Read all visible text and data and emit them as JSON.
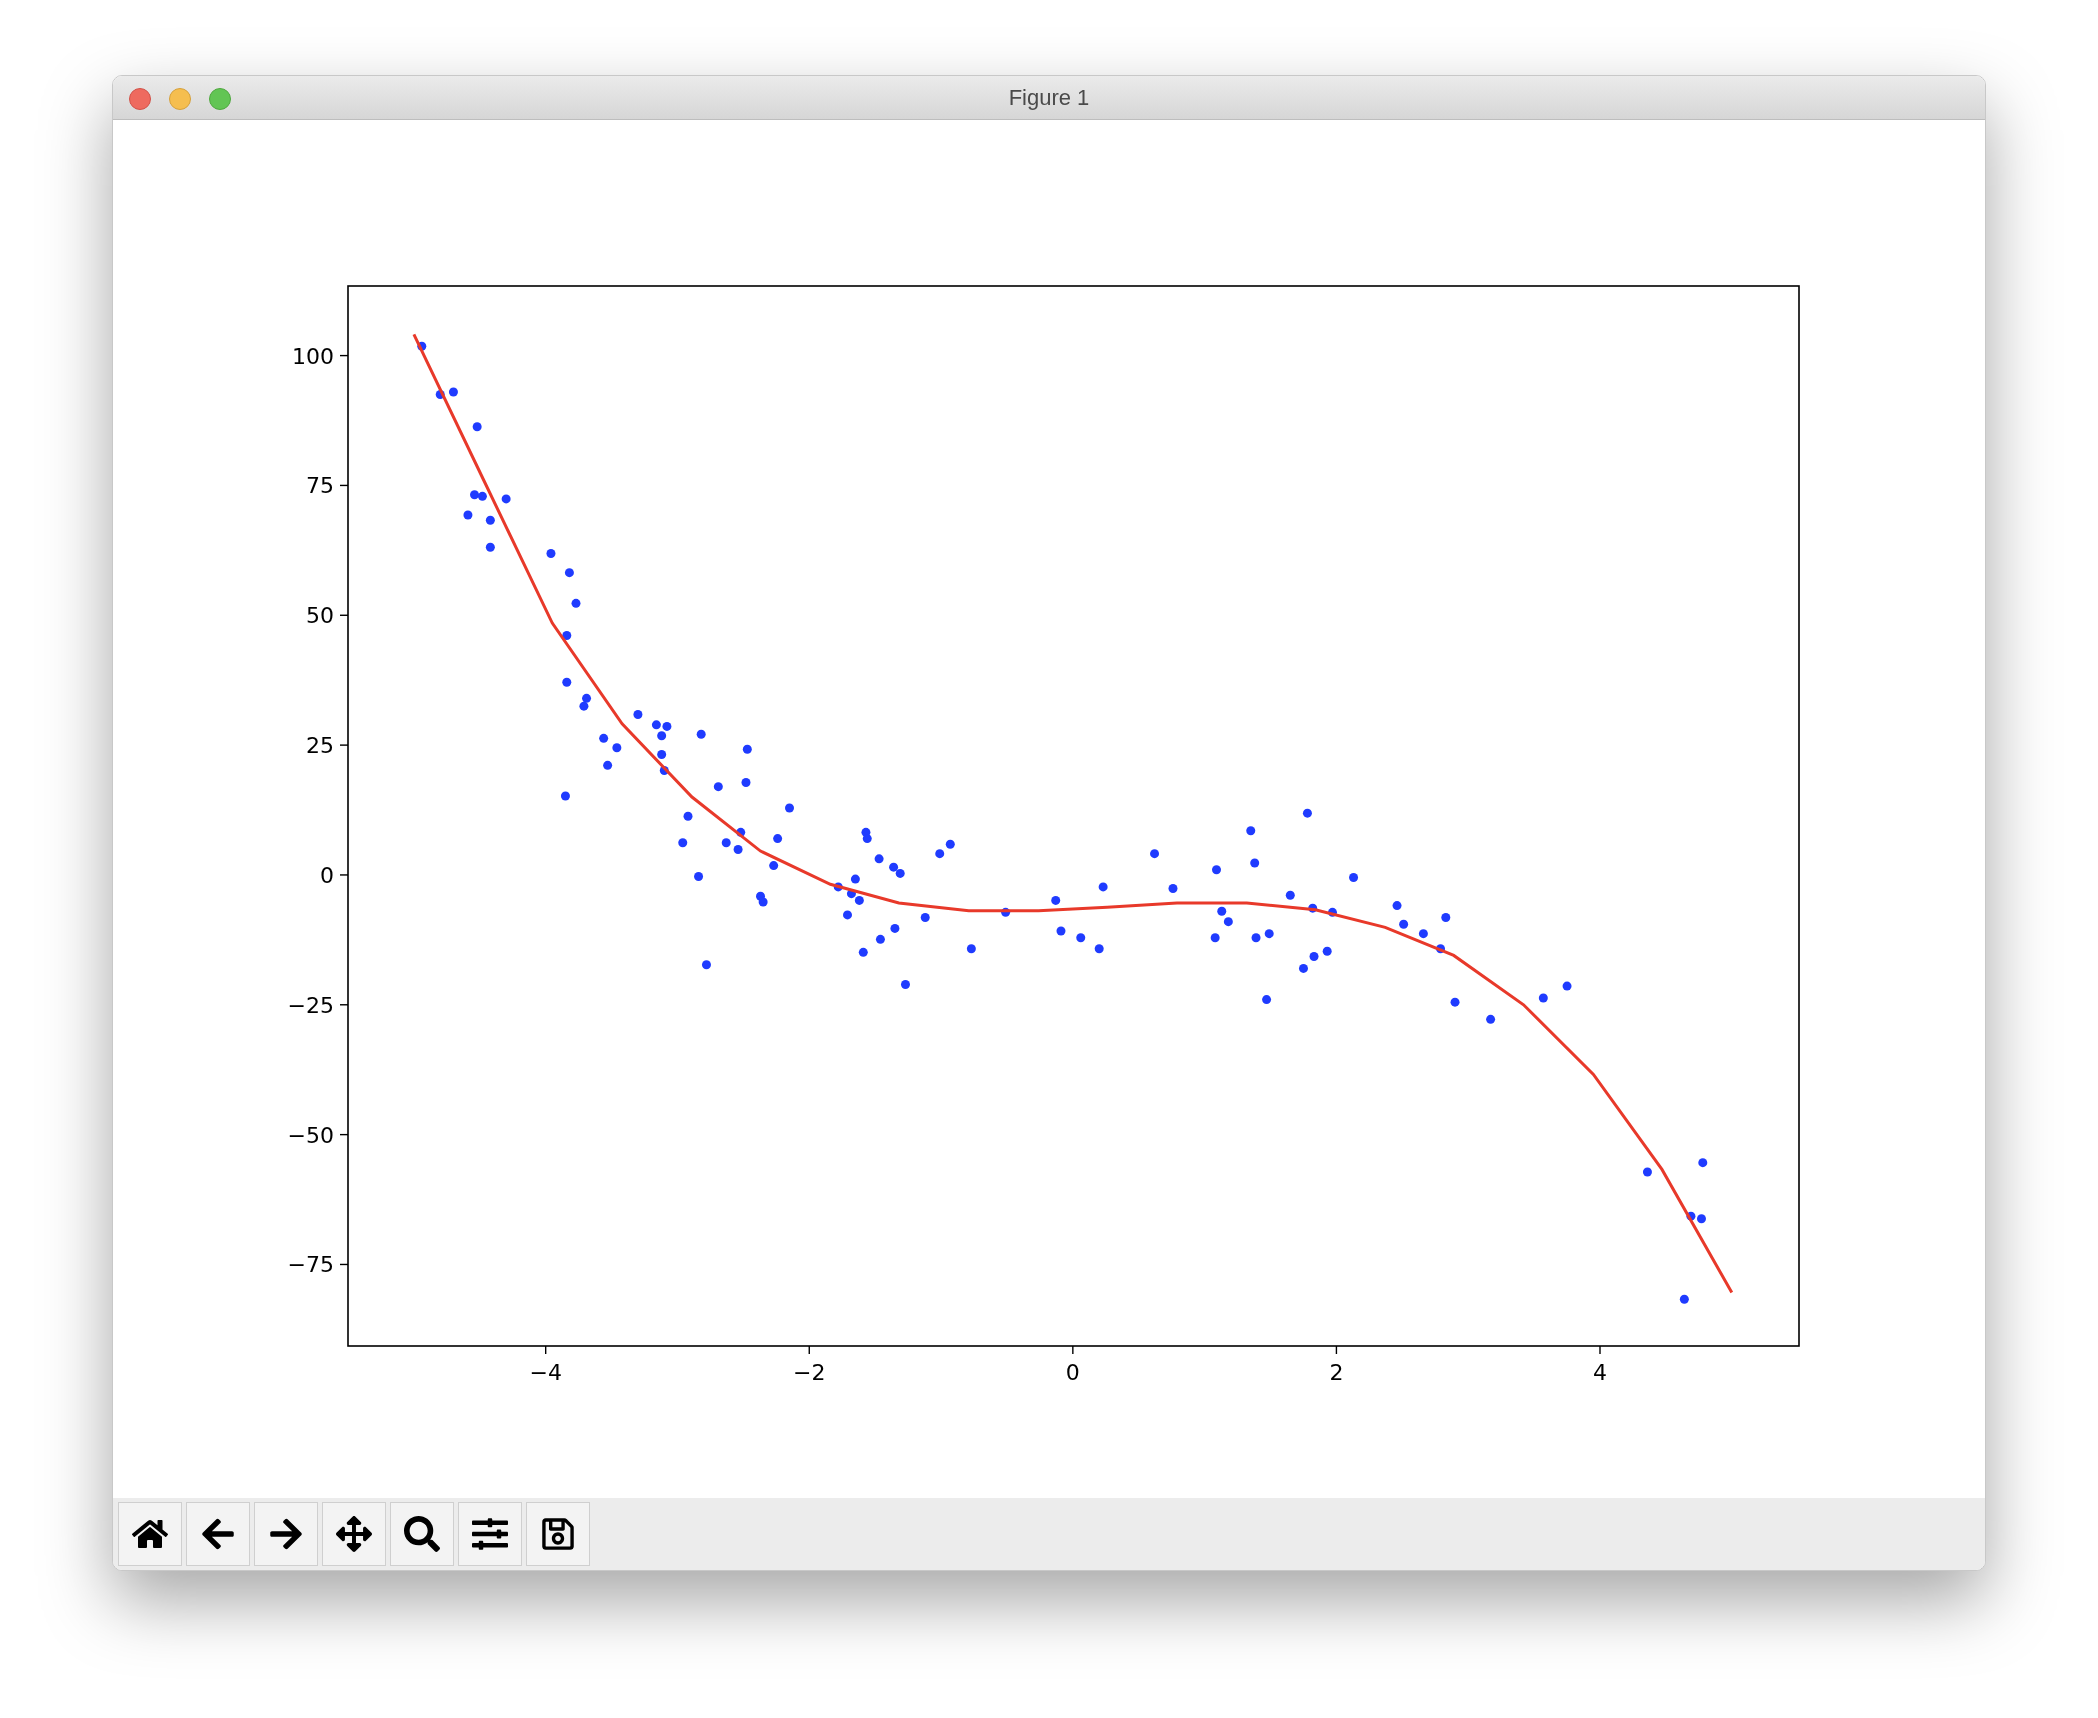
{
  "window": {
    "title": "Figure 1"
  },
  "chart_data": {
    "type": "scatter",
    "xlim": [
      -5.5,
      5.51
    ],
    "ylim": [
      -90.7,
      113.4
    ],
    "xticks": [
      {
        "value": -4,
        "label": "−4"
      },
      {
        "value": -2,
        "label": "−2"
      },
      {
        "value": 0,
        "label": "0"
      },
      {
        "value": 2,
        "label": "2"
      },
      {
        "value": 4,
        "label": "4"
      }
    ],
    "yticks": [
      {
        "value": -75,
        "label": "−75"
      },
      {
        "value": -50,
        "label": "−50"
      },
      {
        "value": -25,
        "label": "−25"
      },
      {
        "value": 0,
        "label": "0"
      },
      {
        "value": 25,
        "label": "25"
      },
      {
        "value": 50,
        "label": "50"
      },
      {
        "value": 75,
        "label": "75"
      },
      {
        "value": 100,
        "label": "100"
      }
    ],
    "series": [
      {
        "type": "scatter",
        "color": "#1f3bff",
        "x": [
          -4.94,
          -4.8,
          -4.7,
          -4.52,
          -4.54,
          -4.48,
          -4.59,
          -4.42,
          -4.42,
          -4.3,
          -3.96,
          -3.82,
          -3.77,
          -3.84,
          -3.84,
          -3.69,
          -3.71,
          -3.56,
          -3.46,
          -3.53,
          -3.85,
          -3.3,
          -3.16,
          -3.08,
          -3.12,
          -3.12,
          -3.1,
          -2.82,
          -2.47,
          -2.48,
          -2.69,
          -2.92,
          -2.15,
          -2.96,
          -2.63,
          -2.52,
          -2.54,
          -2.24,
          -2.27,
          -2.84,
          -2.37,
          -2.35,
          -2.78,
          -1.78,
          -1.68,
          -1.65,
          -1.62,
          -1.71,
          -1.57,
          -1.56,
          -1.47,
          -1.36,
          -1.31,
          -1.59,
          -1.46,
          -1.35,
          -1.27,
          -1.12,
          -1.01,
          -0.93,
          -0.77,
          -0.51,
          -0.13,
          -0.09,
          0.06,
          0.2,
          0.23,
          0.62,
          0.76,
          1.09,
          1.08,
          1.13,
          1.18,
          1.35,
          1.38,
          1.39,
          1.49,
          1.47,
          1.65,
          1.78,
          1.82,
          1.83,
          1.75,
          1.93,
          1.97,
          2.13,
          2.46,
          2.51,
          2.66,
          2.79,
          2.83,
          2.9,
          3.17,
          3.57,
          3.75,
          4.36,
          4.64,
          4.69,
          4.77,
          4.78
        ],
        "values": [
          101.8,
          92.5,
          93,
          86.3,
          73.2,
          72.9,
          69.3,
          68.3,
          63.1,
          72.4,
          61.9,
          58.2,
          52.3,
          46.1,
          37.1,
          34,
          32.5,
          26.3,
          24.5,
          21.1,
          15.2,
          30.9,
          28.9,
          28.6,
          26.8,
          23.2,
          20.1,
          27.1,
          24.2,
          17.8,
          17,
          11.3,
          12.9,
          6.2,
          6.2,
          8.2,
          4.9,
          7,
          1.8,
          -0.3,
          -4.1,
          -5.2,
          -17.3,
          -2.3,
          -3.6,
          -0.8,
          -4.9,
          -7.7,
          8.2,
          7,
          3.1,
          1.5,
          0.3,
          -14.9,
          -12.4,
          -10.3,
          -21.1,
          -8.2,
          4.1,
          5.9,
          -14.2,
          -7.2,
          -4.9,
          -10.8,
          -12.1,
          -14.2,
          -2.3,
          4.1,
          -2.6,
          1,
          -12.1,
          -7,
          -9,
          8.5,
          2.3,
          -12.1,
          -11.3,
          -24,
          -3.9,
          11.9,
          -6.4,
          -15.7,
          -18,
          -14.7,
          -7.2,
          -0.5,
          -5.9,
          -9.5,
          -11.3,
          -14.2,
          -8.2,
          -24.5,
          -27.8,
          -23.7,
          -21.4,
          -57.2,
          -81.7,
          -65.7,
          -66.2,
          -55.4
        ]
      },
      {
        "type": "line",
        "color": "#e8392a",
        "x": [
          -5,
          -4.47,
          -3.95,
          -3.42,
          -2.89,
          -2.37,
          -1.84,
          -1.32,
          -0.79,
          -0.26,
          0.26,
          0.79,
          1.32,
          1.84,
          2.37,
          2.89,
          3.42,
          3.95,
          4.47,
          5
        ],
        "values": [
          104.1,
          76,
          48.5,
          29.1,
          15,
          4.6,
          -1.8,
          -5.4,
          -6.9,
          -6.9,
          -6.2,
          -5.4,
          -5.4,
          -6.7,
          -10.1,
          -15.5,
          -25,
          -38.4,
          -56.7,
          -80.4
        ]
      }
    ]
  }
}
